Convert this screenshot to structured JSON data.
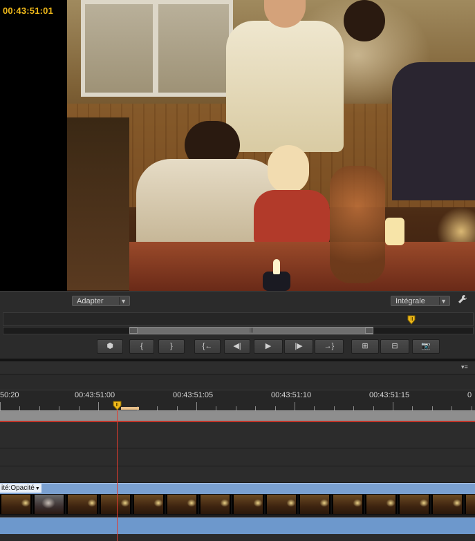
{
  "monitor": {
    "timecode": "00:43:51:01",
    "fit_dropdown": "Adapter",
    "quality_dropdown": "Intégrale"
  },
  "transport": {
    "buttons": [
      {
        "name": "add-marker-button",
        "icon": "marker-icon",
        "glyph": "⬢"
      },
      {
        "name": "mark-in-button",
        "icon": "mark-in-icon",
        "glyph": "{"
      },
      {
        "name": "mark-out-button",
        "icon": "mark-out-icon",
        "glyph": "}"
      },
      {
        "name": "go-to-in-button",
        "icon": "go-to-in-icon",
        "glyph": "{←"
      },
      {
        "name": "step-back-button",
        "icon": "step-back-icon",
        "glyph": "◀|"
      },
      {
        "name": "play-button",
        "icon": "play-icon",
        "glyph": "▶"
      },
      {
        "name": "step-forward-button",
        "icon": "step-forward-icon",
        "glyph": "|▶"
      },
      {
        "name": "go-to-out-button",
        "icon": "go-to-out-icon",
        "glyph": "→}"
      },
      {
        "name": "insert-button",
        "icon": "insert-icon",
        "glyph": "⊞"
      },
      {
        "name": "overwrite-button",
        "icon": "overwrite-icon",
        "glyph": "⊟"
      },
      {
        "name": "export-frame-button",
        "icon": "camera-icon",
        "glyph": "📷"
      }
    ]
  },
  "timeline": {
    "ruler_labels": [
      "50:20",
      "00:43:51:00",
      "00:43:51:05",
      "00:43:51:10",
      "00:43:51:15",
      "0"
    ],
    "clip_label": "ité:Opacité"
  },
  "colors": {
    "timecode": "#f0b91a",
    "playhead": "#e23b2e",
    "video_clip": "#7aa0d0",
    "audio_clip": "#6d98cc"
  }
}
